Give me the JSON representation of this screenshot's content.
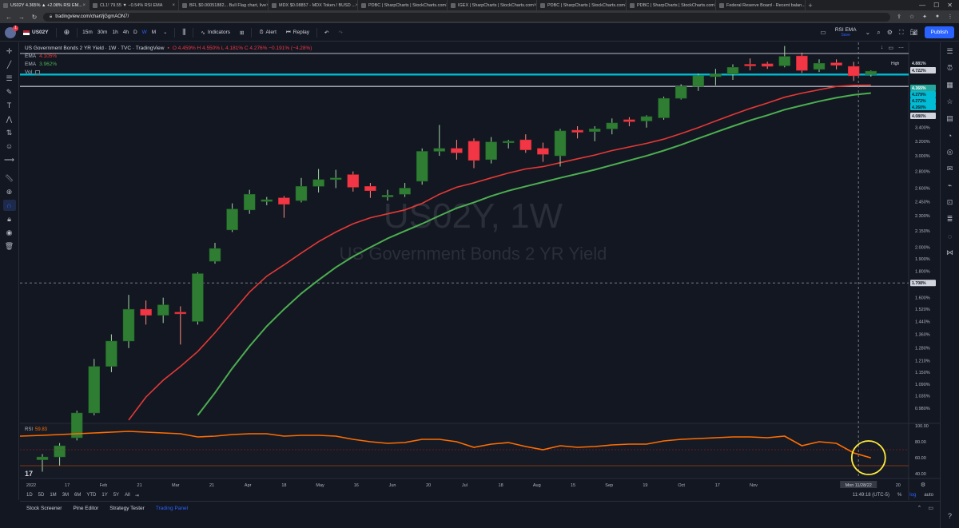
{
  "browser": {
    "tabs": [
      {
        "label": "US02Y 4.365% ▲ +2.08% RSI EM...",
        "active": true
      },
      {
        "label": "CL1! 79.55 ▼ −0.54% RSI EMA",
        "active": false
      },
      {
        "label": "BFL $0.00051882... Bull Flag chart, live",
        "active": false
      },
      {
        "label": "MDX $0.08857 - MDX Token / BUSD ...",
        "active": false
      },
      {
        "label": "PDBC | SharpCharts | StockCharts.com",
        "active": false
      },
      {
        "label": "IGEX | SharpCharts | StockCharts.com",
        "active": false
      },
      {
        "label": "PDBC | SharpCharts | StockCharts.com",
        "active": false
      },
      {
        "label": "PDBC | SharpCharts | StockCharts.com",
        "active": false
      },
      {
        "label": "Federal Reserve Board - Recent balan...",
        "active": false
      }
    ],
    "url": "tradingview.com/chart/jGgmAON7/"
  },
  "toolbar": {
    "symbol": "US02Y",
    "avatar_badge": "1",
    "timeframes": [
      "15m",
      "30m",
      "1h",
      "4h",
      "D",
      "W",
      "M"
    ],
    "active_timeframe": "W",
    "indicators_label": "Indicators",
    "alert_label": "Alert",
    "replay_label": "Replay",
    "layout_name": "RSI EMA",
    "layout_sub": "Save",
    "publish_label": "Publish"
  },
  "legend": {
    "title": "US Government Bonds 2 YR Yield · 1W · TVC · TradingView",
    "ohlc": "O 4.459% H 4.550% L 4.181% C 4.276% −0.191% (−4.28%)",
    "ema1_label": "EMA",
    "ema1_value": "4.105%",
    "ema2_label": "EMA",
    "ema2_value": "3.962%",
    "vol_label": "Vol"
  },
  "watermark": {
    "symbol": "US02Y, 1W",
    "name": "US Government Bonds 2 YR Yield"
  },
  "rsi": {
    "label": "RSI",
    "value": "59.83"
  },
  "bottom": {
    "ranges": [
      "1D",
      "5D",
      "1M",
      "3M",
      "6M",
      "YTD",
      "1Y",
      "5Y",
      "All"
    ],
    "clock": "11:49:18 (UTC-5)",
    "pct": "%",
    "log": "log",
    "auto": "auto",
    "panel_tabs": [
      "Stock Screener",
      "Pine Editor",
      "Strategy Tester",
      "Trading Panel"
    ],
    "active_panel": "Trading Panel"
  },
  "colors": {
    "up": "#26a69a",
    "up_fill": "#1b5e20",
    "down": "#f23645",
    "ema_fast": "#e53935",
    "ema_slow": "#4caf50",
    "rsi": "#ff6d00",
    "cyan_line": "#00bcd4",
    "highlight_circle": "#ffeb3b"
  },
  "chart_data": {
    "type": "candlestick",
    "symbol": "US02Y",
    "interval": "1W",
    "y_unit": "%",
    "y_scale": "log",
    "y_ticks": [
      4.0,
      3.8,
      3.6,
      3.4,
      3.2,
      3.0,
      2.8,
      2.6,
      2.45,
      2.3,
      2.15,
      2.0,
      1.9,
      1.8,
      1.7,
      1.6,
      1.52,
      1.44,
      1.36,
      1.28,
      1.21,
      1.15,
      1.09,
      1.035,
      0.98
    ],
    "x_ticks": [
      "2022",
      "17",
      "Feb",
      "21",
      "Mar",
      "21",
      "Apr",
      "18",
      "May",
      "16",
      "Jun",
      "20",
      "Jul",
      "18",
      "Aug",
      "15",
      "Sep",
      "19",
      "Oct",
      "17",
      "Nov",
      "",
      "",
      "19",
      "20"
    ],
    "crosshair_date": "Mon 11/28/22",
    "price_labels": [
      {
        "label": "High",
        "value": "4.881%"
      },
      {
        "value": "4.722%"
      },
      {
        "value": "4.365%"
      },
      {
        "value": "4.279%"
      },
      {
        "value": "4.272%"
      },
      {
        "value": "4.260%"
      },
      {
        "value": "4.080%"
      },
      {
        "value": "1.708%"
      }
    ],
    "candles": [
      {
        "o": 0.78,
        "h": 0.8,
        "l": 0.74,
        "c": 0.79
      },
      {
        "o": 0.79,
        "h": 0.84,
        "l": 0.76,
        "c": 0.83
      },
      {
        "o": 0.86,
        "h": 0.97,
        "l": 0.85,
        "c": 0.96
      },
      {
        "o": 0.96,
        "h": 1.22,
        "l": 0.95,
        "c": 1.18
      },
      {
        "o": 1.18,
        "h": 1.36,
        "l": 1.15,
        "c": 1.32
      },
      {
        "o": 1.32,
        "h": 1.62,
        "l": 1.28,
        "c": 1.52
      },
      {
        "o": 1.52,
        "h": 1.58,
        "l": 1.42,
        "c": 1.48
      },
      {
        "o": 1.48,
        "h": 1.6,
        "l": 1.43,
        "c": 1.55
      },
      {
        "o": 1.5,
        "h": 1.54,
        "l": 1.3,
        "c": 1.49
      },
      {
        "o": 1.44,
        "h": 1.79,
        "l": 1.42,
        "c": 1.78
      },
      {
        "o": 1.88,
        "h": 2.04,
        "l": 1.86,
        "c": 1.99
      },
      {
        "o": 2.16,
        "h": 2.43,
        "l": 2.14,
        "c": 2.37
      },
      {
        "o": 2.36,
        "h": 2.58,
        "l": 2.32,
        "c": 2.53
      },
      {
        "o": 2.45,
        "h": 2.5,
        "l": 2.41,
        "c": 2.47
      },
      {
        "o": 2.49,
        "h": 2.51,
        "l": 2.28,
        "c": 2.42
      },
      {
        "o": 2.46,
        "h": 2.72,
        "l": 2.44,
        "c": 2.62
      },
      {
        "o": 2.62,
        "h": 2.83,
        "l": 2.55,
        "c": 2.7
      },
      {
        "o": 2.7,
        "h": 2.82,
        "l": 2.6,
        "c": 2.72
      },
      {
        "o": 2.76,
        "h": 2.8,
        "l": 2.56,
        "c": 2.61
      },
      {
        "o": 2.62,
        "h": 2.66,
        "l": 2.49,
        "c": 2.57
      },
      {
        "o": 2.5,
        "h": 2.58,
        "l": 2.46,
        "c": 2.52
      },
      {
        "o": 2.53,
        "h": 2.66,
        "l": 2.5,
        "c": 2.6
      },
      {
        "o": 2.68,
        "h": 3.1,
        "l": 2.64,
        "c": 3.06
      },
      {
        "o": 3.06,
        "h": 3.44,
        "l": 3.0,
        "c": 3.1
      },
      {
        "o": 3.1,
        "h": 3.22,
        "l": 2.95,
        "c": 3.04
      },
      {
        "o": 3.2,
        "h": 3.24,
        "l": 2.84,
        "c": 2.94
      },
      {
        "o": 2.95,
        "h": 3.26,
        "l": 2.9,
        "c": 3.19
      },
      {
        "o": 3.19,
        "h": 3.22,
        "l": 3.1,
        "c": 3.2
      },
      {
        "o": 3.22,
        "h": 3.3,
        "l": 3.04,
        "c": 3.08
      },
      {
        "o": 3.1,
        "h": 3.18,
        "l": 2.92,
        "c": 3.02
      },
      {
        "o": 3.0,
        "h": 3.38,
        "l": 2.86,
        "c": 3.35
      },
      {
        "o": 3.36,
        "h": 3.42,
        "l": 3.24,
        "c": 3.33
      },
      {
        "o": 3.34,
        "h": 3.42,
        "l": 3.2,
        "c": 3.38
      },
      {
        "o": 3.38,
        "h": 3.54,
        "l": 3.3,
        "c": 3.47
      },
      {
        "o": 3.52,
        "h": 3.56,
        "l": 3.42,
        "c": 3.49
      },
      {
        "o": 3.5,
        "h": 3.59,
        "l": 3.4,
        "c": 3.57
      },
      {
        "o": 3.55,
        "h": 3.9,
        "l": 3.52,
        "c": 3.87
      },
      {
        "o": 3.87,
        "h": 4.12,
        "l": 3.85,
        "c": 4.08
      },
      {
        "o": 4.08,
        "h": 4.32,
        "l": 4.0,
        "c": 4.28
      },
      {
        "o": 4.26,
        "h": 4.41,
        "l": 4.1,
        "c": 4.31
      },
      {
        "o": 4.31,
        "h": 4.5,
        "l": 4.2,
        "c": 4.44
      },
      {
        "o": 4.5,
        "h": 4.62,
        "l": 4.38,
        "c": 4.48
      },
      {
        "o": 4.51,
        "h": 4.55,
        "l": 4.41,
        "c": 4.46
      },
      {
        "o": 4.47,
        "h": 4.88,
        "l": 4.44,
        "c": 4.66
      },
      {
        "o": 4.67,
        "h": 4.74,
        "l": 4.33,
        "c": 4.38
      },
      {
        "o": 4.4,
        "h": 4.6,
        "l": 4.35,
        "c": 4.52
      },
      {
        "o": 4.53,
        "h": 4.6,
        "l": 4.4,
        "c": 4.48
      },
      {
        "o": 4.459,
        "h": 4.55,
        "l": 4.181,
        "c": 4.276
      },
      {
        "o": 4.3,
        "h": 4.38,
        "l": 4.26,
        "c": 4.365
      }
    ],
    "ema_fast": [
      0.55,
      0.6,
      0.66,
      0.74,
      0.83,
      0.93,
      1.03,
      1.11,
      1.18,
      1.26,
      1.37,
      1.5,
      1.64,
      1.76,
      1.85,
      1.95,
      2.05,
      2.14,
      2.22,
      2.28,
      2.32,
      2.36,
      2.43,
      2.53,
      2.61,
      2.66,
      2.72,
      2.78,
      2.83,
      2.86,
      2.91,
      2.96,
      3.01,
      3.07,
      3.12,
      3.17,
      3.23,
      3.31,
      3.4,
      3.5,
      3.6,
      3.7,
      3.79,
      3.89,
      3.96,
      4.02,
      4.08,
      4.1,
      4.105
    ],
    "ema_slow": [
      0.35,
      0.38,
      0.42,
      0.48,
      0.55,
      0.62,
      0.7,
      0.78,
      0.86,
      0.95,
      1.05,
      1.17,
      1.29,
      1.41,
      1.52,
      1.63,
      1.73,
      1.83,
      1.92,
      2.0,
      2.08,
      2.15,
      2.22,
      2.3,
      2.38,
      2.44,
      2.51,
      2.57,
      2.62,
      2.67,
      2.72,
      2.77,
      2.82,
      2.88,
      2.94,
      3.0,
      3.07,
      3.15,
      3.24,
      3.33,
      3.42,
      3.51,
      3.59,
      3.68,
      3.75,
      3.82,
      3.88,
      3.93,
      3.962
    ],
    "rsi_values": [
      88,
      89,
      90,
      91,
      92,
      93,
      92,
      91,
      90,
      86,
      87,
      89,
      90,
      90,
      87,
      88,
      88,
      87,
      83,
      80,
      78,
      79,
      83,
      83,
      80,
      73,
      77,
      79,
      74,
      70,
      75,
      73,
      74,
      76,
      77,
      77,
      81,
      83,
      84,
      85,
      86,
      86,
      85,
      87,
      75,
      80,
      78,
      66,
      59.83
    ],
    "rsi_ticks": [
      80,
      60,
      40,
      100
    ],
    "rsi_level_lines": [
      70,
      50
    ]
  }
}
